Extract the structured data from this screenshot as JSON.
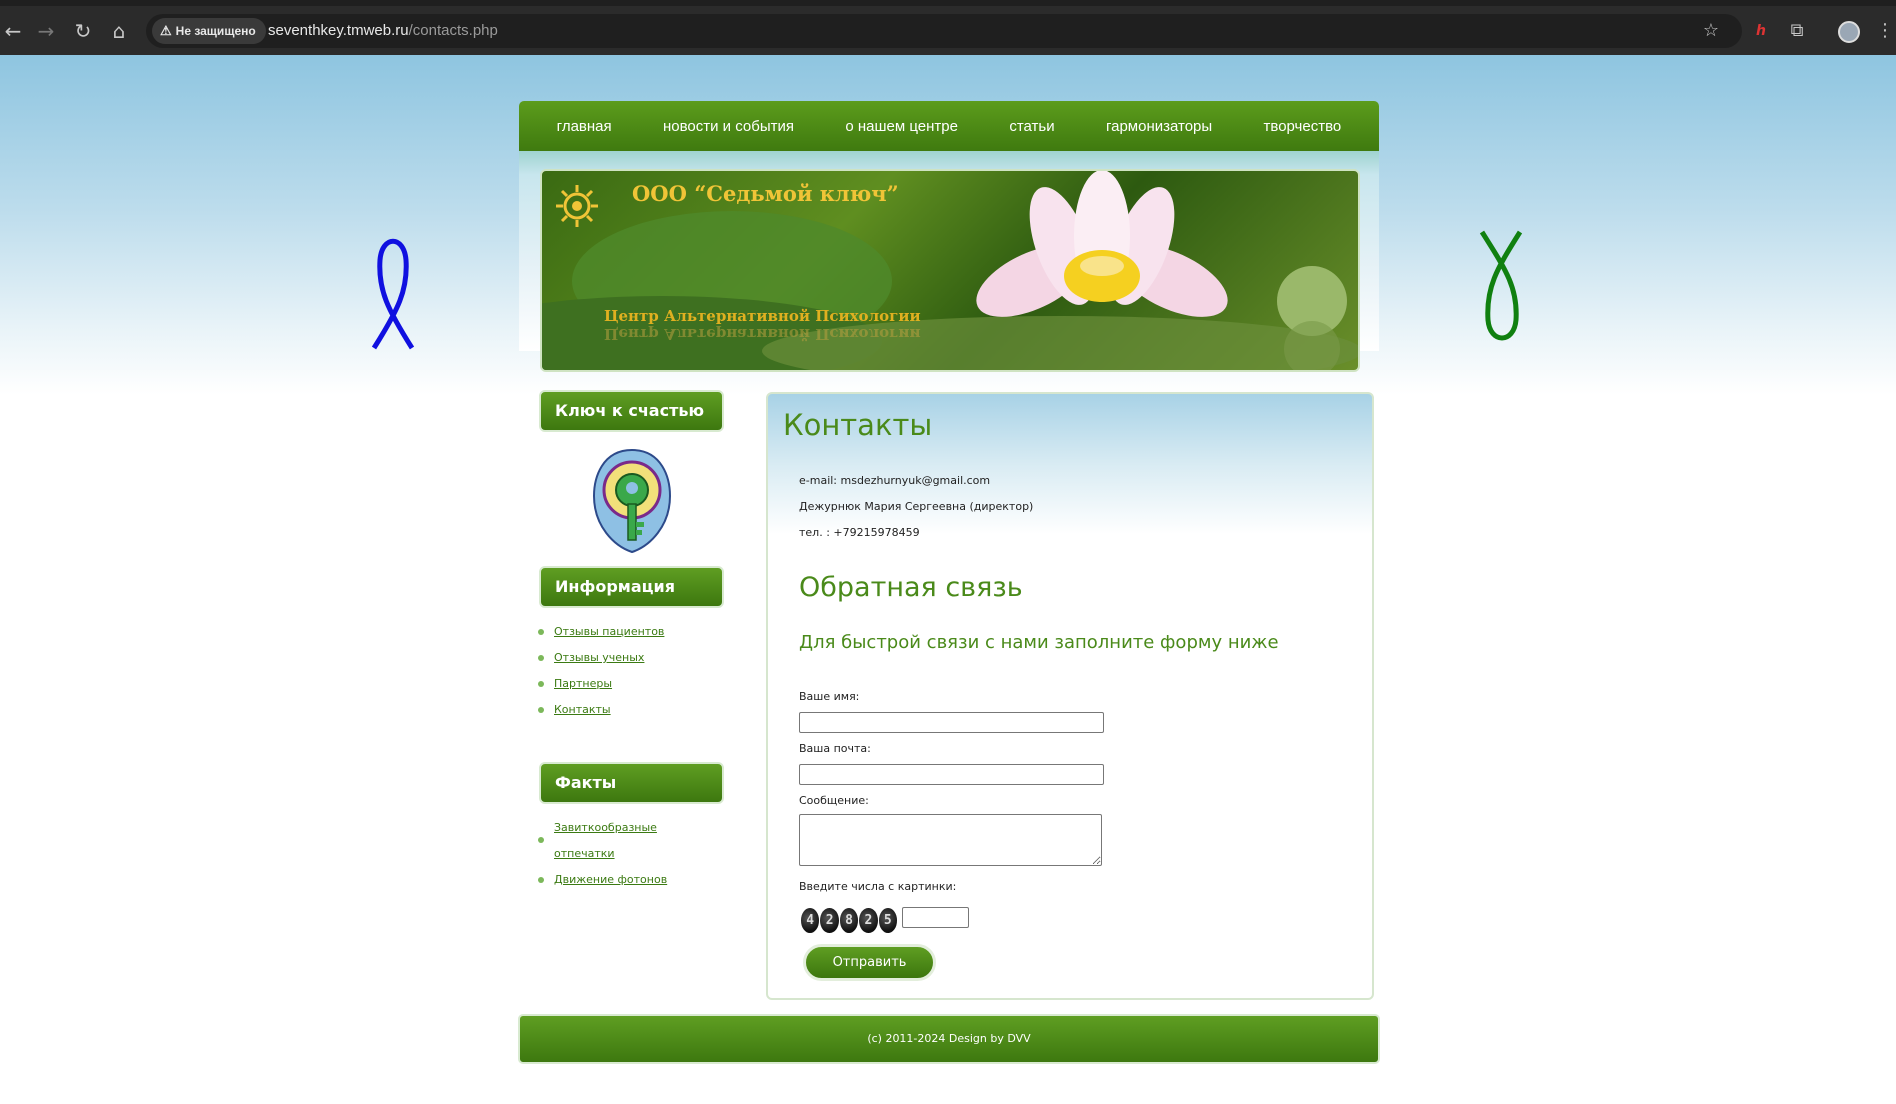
{
  "browser": {
    "security_label": "Не защищено",
    "url_host": "seventhkey.tmweb.ru",
    "url_path": "/contacts.php"
  },
  "nav": {
    "items": [
      "главная",
      "новости и события",
      "о нашем центре",
      "статьи",
      "гармонизаторы",
      "творчество"
    ]
  },
  "banner": {
    "title": "ООО “Седьмой ключ”",
    "subtitle": "Центр Альтернативной Психологии"
  },
  "sidebar": {
    "key_title": "Ключ к счастью",
    "info_title": "Информация",
    "info_links": [
      "Отзывы пациентов",
      "Отзывы ученых",
      "Партнеры",
      "Контакты"
    ],
    "facts_title": "Факты",
    "facts_links": [
      "Завиткообразные отпечатки",
      "Движение фотонов"
    ]
  },
  "content": {
    "title": "Контакты",
    "email_line": "e-mail: msdezhurnyuk@gmail.com",
    "person_line": "Дежурнюк Мария Сергеевна (директор)",
    "phone_line": "тел. : +79215978459",
    "feedback_title": "Обратная связь",
    "feedback_subtitle": "Для быстрой связи с нами заполните форму ниже",
    "form": {
      "name_label": "Ваше имя:",
      "email_label": "Ваша почта:",
      "message_label": "Сообщение:",
      "captcha_label": "Введите числа с картинки:",
      "captcha_digits": [
        "4",
        "2",
        "8",
        "2",
        "5"
      ],
      "submit_label": "Отправить"
    }
  },
  "footer": {
    "text": "(c) 2011-2024 Design by DVV"
  },
  "colors": {
    "brand_green": "#4a8a1a",
    "ribbon_blue": "#1010e0",
    "ribbon_green": "#108010"
  },
  "icons": [
    "back-icon",
    "forward-icon",
    "reload-icon",
    "home-icon",
    "warning-icon",
    "star-icon",
    "extension-icon",
    "profile-avatar",
    "menu-icon"
  ]
}
